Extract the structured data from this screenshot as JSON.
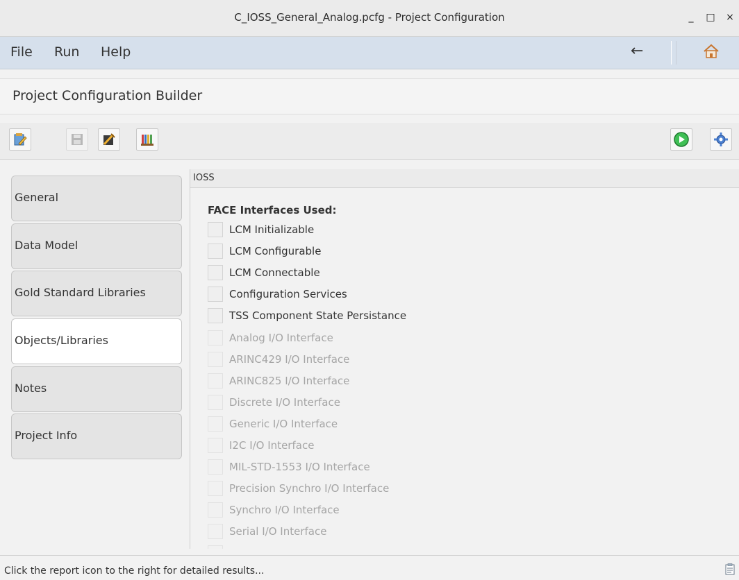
{
  "window": {
    "title": "C_IOSS_General_Analog.pcfg - Project Configuration",
    "minimize": "_",
    "maximize": "□",
    "close": "×"
  },
  "menubar": {
    "items": [
      "File",
      "Run",
      "Help"
    ],
    "back_icon": "back-arrow-icon",
    "home_icon": "home-icon"
  },
  "header": {
    "title": "Project Configuration Builder"
  },
  "toolbar": {
    "left_icons": [
      "edit-icon",
      "save-icon",
      "wizard-icon",
      "library-icon"
    ],
    "right_icons": [
      "run-icon",
      "settings-icon"
    ]
  },
  "sidebar": {
    "items": [
      {
        "label": "General"
      },
      {
        "label": "Data Model"
      },
      {
        "label": "Gold Standard Libraries"
      },
      {
        "label": "Objects/Libraries",
        "active": true
      },
      {
        "label": "Notes"
      },
      {
        "label": "Project Info"
      }
    ]
  },
  "panel": {
    "header": "IOSS",
    "section_title": "FACE Interfaces Used:",
    "checkboxes": [
      {
        "label": "LCM Initializable",
        "enabled": true,
        "checked": false
      },
      {
        "label": "LCM Configurable",
        "enabled": true,
        "checked": false
      },
      {
        "label": "LCM Connectable",
        "enabled": true,
        "checked": false
      },
      {
        "label": "Configuration Services",
        "enabled": true,
        "checked": false
      },
      {
        "label": "TSS Component State Persistance",
        "enabled": true,
        "checked": false
      },
      {
        "label": "Analog I/O Interface",
        "enabled": false,
        "checked": false
      },
      {
        "label": "ARINC429 I/O Interface",
        "enabled": false,
        "checked": false
      },
      {
        "label": "ARINC825 I/O Interface",
        "enabled": false,
        "checked": false
      },
      {
        "label": "Discrete I/O Interface",
        "enabled": false,
        "checked": false
      },
      {
        "label": "Generic I/O Interface",
        "enabled": false,
        "checked": false
      },
      {
        "label": "I2C I/O Interface",
        "enabled": false,
        "checked": false
      },
      {
        "label": "MIL-STD-1553 I/O Interface",
        "enabled": false,
        "checked": false
      },
      {
        "label": "Precision Synchro I/O Interface",
        "enabled": false,
        "checked": false
      },
      {
        "label": "Synchro I/O Interface",
        "enabled": false,
        "checked": false
      },
      {
        "label": "Serial I/O Interface",
        "enabled": false,
        "checked": false
      }
    ]
  },
  "statusbar": {
    "message": "Click the report icon to the right for detailed results...",
    "report_icon": "report-icon"
  }
}
